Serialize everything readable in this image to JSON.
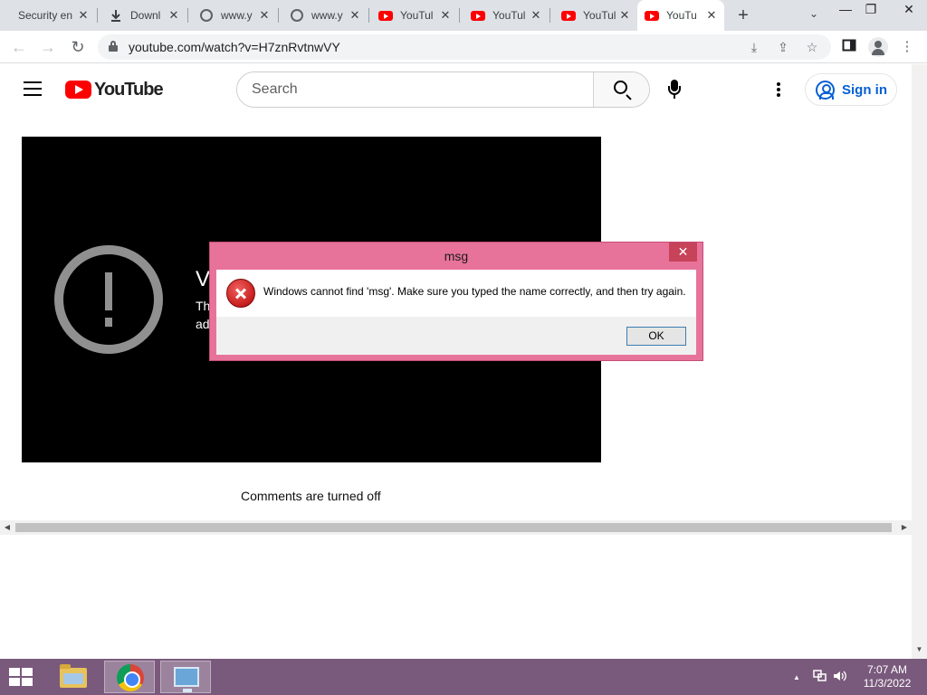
{
  "browser": {
    "tabs": [
      {
        "title": "Security en",
        "favicon": "none"
      },
      {
        "title": "Downl",
        "favicon": "download-icon"
      },
      {
        "title": "www.y",
        "favicon": "globe-icon"
      },
      {
        "title": "www.y",
        "favicon": "globe-icon"
      },
      {
        "title": "YouTul",
        "favicon": "youtube-icon"
      },
      {
        "title": "YouTul",
        "favicon": "youtube-icon"
      },
      {
        "title": "YouTul",
        "favicon": "youtube-icon"
      },
      {
        "title": "YouTu",
        "favicon": "youtube-icon",
        "active": true
      }
    ],
    "close_glyph": "✕",
    "new_tab_glyph": "+",
    "tab_search_glyph": "⌄",
    "window_controls": {
      "minimize": "—",
      "restore": "❐",
      "close": "✕"
    },
    "url": "youtube.com/watch?v=H7znRvtnwVY"
  },
  "youtube": {
    "logo_text": "YouTube",
    "search_placeholder": "Search",
    "sign_in_label": "Sign in",
    "video": {
      "title_partial": "V",
      "subtitle_partial": "Th\nad"
    },
    "comments_text": "Comments are turned off"
  },
  "dialog": {
    "title": "msg",
    "close_glyph": "✕",
    "message": "Windows cannot find 'msg'. Make sure you typed the name correctly, and then try again.",
    "ok_label": "OK"
  },
  "taskbar": {
    "time": "7:07 AM",
    "date": "11/3/2022",
    "tray_arrow": "▲"
  },
  "colors": {
    "youtube_red": "#ff0000",
    "link_blue": "#065fd4",
    "dialog_frame": "#e8739a",
    "taskbar": "#7a5a7c"
  }
}
